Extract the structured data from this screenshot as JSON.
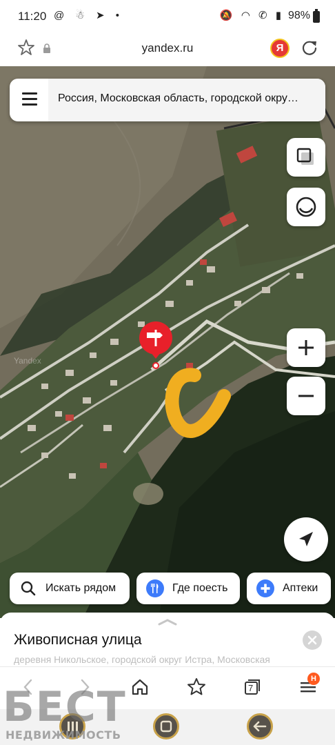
{
  "status_bar": {
    "time": "11:20",
    "left_icons": [
      "@",
      "notification-icon",
      "telegram-icon",
      "dot"
    ],
    "right_icons": [
      "mute-icon",
      "wifi-icon",
      "call-icon",
      "signal-icon"
    ],
    "battery": "98%"
  },
  "address_bar": {
    "url": "yandex.ru",
    "ya_badge": "Я"
  },
  "map": {
    "search_text": "Россия, Московская область, городской окру…",
    "watermark": "Yandex",
    "chips": [
      {
        "label": "Искать рядом",
        "icon": "search-icon"
      },
      {
        "label": "Где поесть",
        "icon": "fork-knife-icon",
        "color": "#3d7bfa"
      },
      {
        "label": "Аптеки",
        "icon": "pharmacy-cross-icon",
        "color": "#3d7bfa"
      }
    ],
    "pin_color": "#e8202a",
    "annotation_color": "#f0ae20"
  },
  "place": {
    "title": "Живописная улица",
    "subtitle": "деревня Никольское, городской округ Истра, Московская"
  },
  "browser_nav": {
    "tabs_count": "7",
    "badge": "Н"
  },
  "watermark": {
    "big": "БЕСТ",
    "small": "НЕДВИЖИМОСТЬ"
  }
}
